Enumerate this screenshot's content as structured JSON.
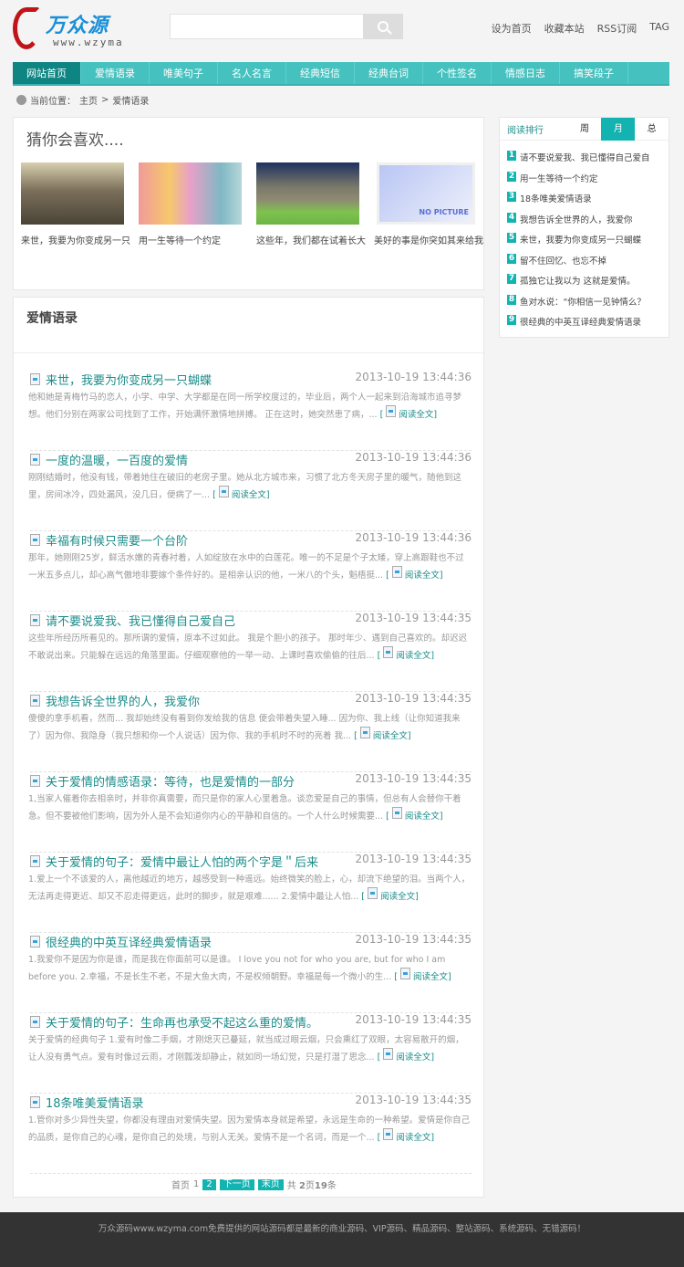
{
  "logo": {
    "cn": "万众源",
    "en": "www.wzyma"
  },
  "search": {
    "placeholder": ""
  },
  "toplinks": [
    "设为首页",
    "收藏本站",
    "RSS订阅",
    "TAG"
  ],
  "nav": [
    "网站首页",
    "爱情语录",
    "唯美句子",
    "名人名言",
    "经典短信",
    "经典台词",
    "个性签名",
    "情感日志",
    "搞笑段子"
  ],
  "breadcrumb": {
    "label": "当前位置：",
    "home": "主页",
    "sep": ">",
    "current": "爱情语录"
  },
  "guess": {
    "title": "猜你会喜欢....",
    "items": [
      {
        "caption": "来世，我要为你变成另一只"
      },
      {
        "caption": "用一生等待一个约定"
      },
      {
        "caption": "这些年，我们都在试着长大"
      },
      {
        "caption": "美好的事是你突如其来给我",
        "image_text": "NO PICTURE"
      }
    ]
  },
  "list": {
    "title": "爱情语录",
    "read_more": "阅读全文",
    "articles": [
      {
        "title": "来世，我要为你变成另一只蝴蝶",
        "date": "2013-10-19 13:44:36",
        "summary": "他和她是青梅竹马的恋人，小学、中学、大学都是在同一所学校度过的，毕业后，两个人一起来到沿海城市追寻梦想。他们分别在两家公司找到了工作，开始满怀激情地拼搏。 正在这时，她突然患了病，..."
      },
      {
        "title": "一度的温暖，一百度的爱情",
        "date": "2013-10-19 13:44:36",
        "summary": "刚刚结婚时，他没有钱，带着她住在破旧的老房子里。她从北方城市来，习惯了北方冬天房子里的暖气，随他到这里，房间冰冷，四处漏风，没几日，便病了一..."
      },
      {
        "title": "幸福有时候只需要一个台阶",
        "date": "2013-10-19 13:44:36",
        "summary": "那年，她刚刚25岁，鲜活水嫩的青春衬着，人如绽放在水中的白莲花。唯一的不足是个子太矮，穿上高跟鞋也不过一米五多点儿，却心高气傲地非要嫁个条件好的。是相亲认识的他，一米八的个头，魁梧挺..."
      },
      {
        "title": "请不要说爱我、我已懂得自己爱自己",
        "date": "2013-10-19 13:44:35",
        "summary": "这些年所经历所看见的。那所谓的爱情，原本不过如此。 我是个胆小的孩子。 那时年少、遇到自己喜欢的。却迟迟不敢说出来。只能躲在远远的角落里面。仔细观察他的一举一动、上课时喜欢偷偷的往后..."
      },
      {
        "title": "我想告诉全世界的人，我爱你",
        "date": "2013-10-19 13:44:35",
        "summary": "傻傻的拿手机看，然而... 我却始终没有看到你发给我的信息 便会带着失望入睡... 因为你、我上线（让你知道我来了）因为你、我隐身（我只想和你一个人说话）因为你、我的手机时不时的亮着 我..."
      },
      {
        "title": "关于爱情的情感语录：等待，也是爱情的一部分",
        "date": "2013-10-19 13:44:35",
        "summary": "1,当家人催着你去相亲时，并非你真需要，而只是你的家人心里着急。谈恋爱是自己的事情，但总有人会替你干着急。但不要被他们影响，因为外人是不会知道你内心的平静和自信的。一个人什么时候需要..."
      },
      {
        "title": "关于爱情的句子：爱情中最让人怕的两个字是＂后来",
        "date": "2013-10-19 13:44:35",
        "summary": "1.爱上一个不该爱的人，离他越近的地方，越感受到一种遥远。始终微笑的脸上，心，却流下绝望的泪。当两个人，无法再走得更近、却又不忍走得更远，此时的脚步，就是艰难...... 2.爱情中最让人怕..."
      },
      {
        "title": "很经典的中英互译经典爱情语录",
        "date": "2013-10-19 13:44:35",
        "summary": "1.我爱你不是因为你是谁，而是我在你面前可以是谁。 I love you not for who you are, but for who I am before you. 2.幸福，不是长生不老，不是大鱼大肉，不是权倾朝野。幸福是每一个微小的生..."
      },
      {
        "title": "关于爱情的句子：生命再也承受不起这么重的爱情。",
        "date": "2013-10-19 13:44:35",
        "summary": "关于爱情的经典句子 1.爱有时像二手烟，才刚熄灭已蔓延，就当成过眼云烟，只会熏红了双眼，太容易散开的烟，让人没有勇气点。爱有时像过云雨，才刚瓢泼却静止，就如同一场幻觉，只是打湿了思念..."
      },
      {
        "title": "18条唯美爱情语录",
        "date": "2013-10-19 13:44:35",
        "summary": "1.管你对多少异性失望，你都没有理由对爱情失望。因为爱情本身就是希望，永远是生命的一种希望。爱情是你自己的品质，是你自己的心魂，是你自己的处境，与别人无关。爱情不是一个名词，而是一个..."
      }
    ]
  },
  "pager": {
    "first": "首页",
    "p1": "1",
    "p2": "2",
    "next": "下一页",
    "last": "末页",
    "total_pre": "共",
    "pages": "2",
    "pages_unit": "页",
    "count": "19",
    "count_unit": "条"
  },
  "sidebar": {
    "title": "阅读排行",
    "tabs": [
      "周",
      "月",
      "总"
    ],
    "active_tab": "月",
    "items": [
      "请不要说爱我、我已懂得自己爱自",
      "用一生等待一个约定",
      "18条唯美爱情语录",
      "我想告诉全世界的人，我爱你",
      "来世，我要为你变成另一只蝴蝶",
      "留不住回忆、也忘不掉",
      "孤独它让我以为 这就是爱情。",
      "鱼对水说：“你相信一见钟情么？",
      "很经典的中英互译经典爱情语录"
    ]
  },
  "footer": {
    "text": "万众源码www.wzyma.com免费提供的网站源码都是最新的商业源码、VIP源码、精品源码、整站源码、系统源码、无错源码！"
  },
  "colors": {
    "accent": "#45c1bf",
    "accent_dark": "#0e8582",
    "badge": "#12b3b0",
    "footer_bg": "#333333"
  }
}
